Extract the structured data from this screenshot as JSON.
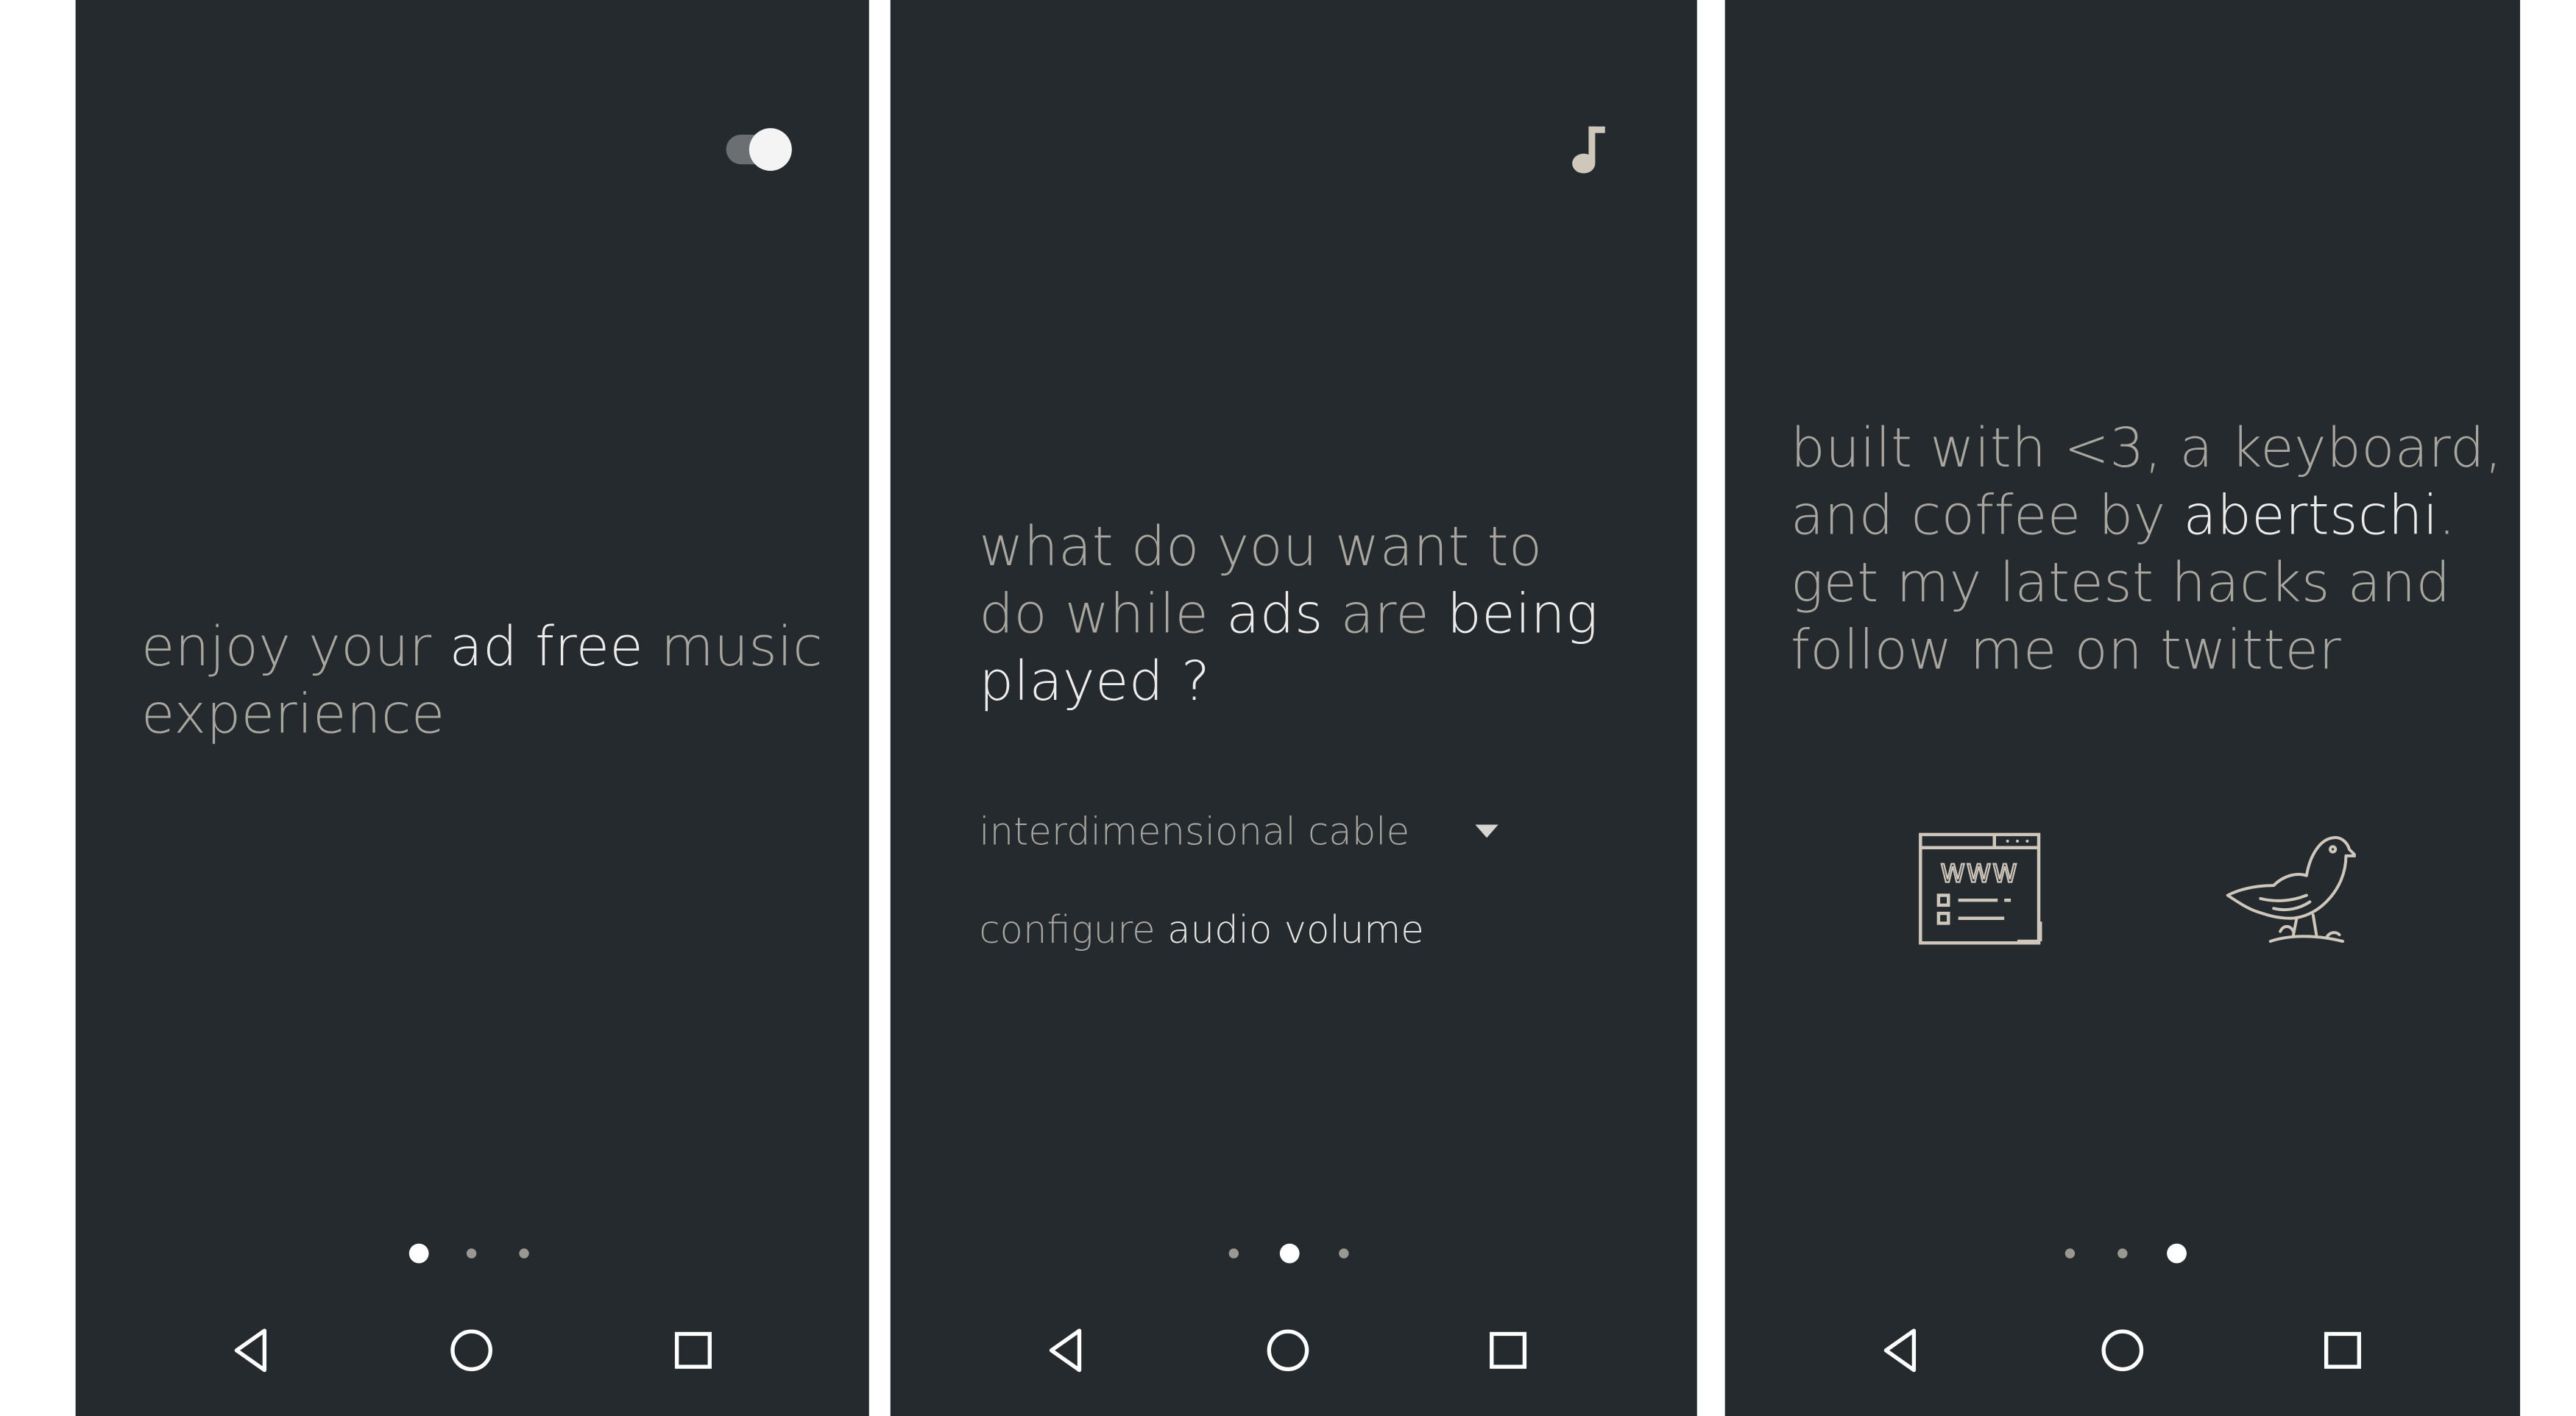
{
  "colors": {
    "screen_background": "#252a2e",
    "text_dim": "#a9a59f",
    "text_highlight": "#eeecea",
    "icon_tint": "#cfc6bc",
    "page_indicator_active": "#ffffff",
    "page_indicator_inactive": "#9b9894"
  },
  "screens": [
    {
      "icon": "toggle-switch-icon",
      "toggle_state": "on",
      "headline": {
        "s1": "enjoy your ",
        "s2": "ad free",
        "s3": " music",
        "s4": "experience"
      },
      "page_indicator": {
        "count": 3,
        "active": 1
      },
      "navbar": [
        "back-icon",
        "home-icon",
        "recents-icon"
      ]
    },
    {
      "icon": "music-note-icon",
      "headline": {
        "s1": "what do you want to",
        "s2": "do while ",
        "s3": "ads",
        "s4": " are ",
        "s5": "being",
        "s6": "played ?"
      },
      "selected_option": "interdimensional cable",
      "configure_text": "configure",
      "configure_link": "audio volume",
      "page_indicator": {
        "count": 3,
        "active": 2
      },
      "navbar": [
        "back-icon",
        "home-icon",
        "recents-icon"
      ]
    },
    {
      "headline": {
        "s1": "built with <3, a keyboard,",
        "s2": "and coffee by ",
        "s3": "abertschi",
        "s4": ".",
        "s5": "get my latest hacks and",
        "s6": "follow me on twitter"
      },
      "website_icon_text": "WWW",
      "icons": [
        "website-icon",
        "twitter-bird-icon"
      ],
      "page_indicator": {
        "count": 3,
        "active": 3
      },
      "navbar": [
        "back-icon",
        "home-icon",
        "recents-icon"
      ]
    }
  ]
}
